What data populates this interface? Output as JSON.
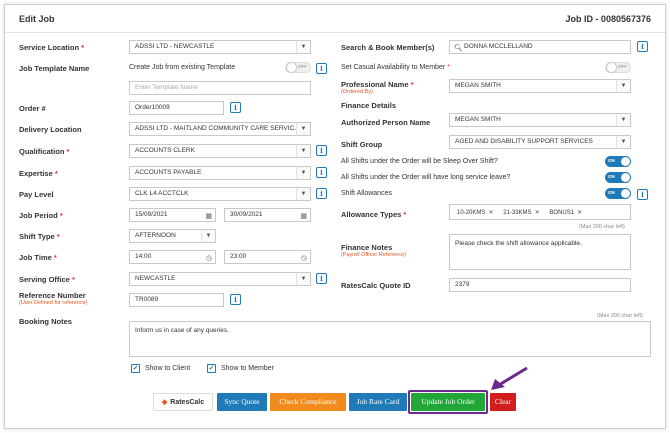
{
  "header": {
    "title": "Edit Job",
    "job_id": "Job ID - 0080567376"
  },
  "left": {
    "service_location": {
      "label": "Service Location",
      "value": "ADSSI LTD - NEWCASTLE"
    },
    "job_template": {
      "label": "Job Template Name",
      "option_label": "Create Job from existing Template",
      "toggle": "OFF",
      "placeholder": "Enter Template Name"
    },
    "order_no": {
      "label": "Order #",
      "value": "Order10009"
    },
    "delivery_location": {
      "label": "Delivery Location",
      "value": "ADSSI LTD - MAITLAND COMMUNITY CARE SERVIC..."
    },
    "qualification": {
      "label": "Qualification",
      "value": "ACCOUNTS CLERK"
    },
    "expertise": {
      "label": "Expertise",
      "value": "ACCOUNTS PAYABLE"
    },
    "pay_level": {
      "label": "Pay Level",
      "value": "CLK L4 ACCTCLK"
    },
    "job_period": {
      "label": "Job Period",
      "start": "15/09/2021",
      "end": "30/09/2021"
    },
    "shift_type": {
      "label": "Shift Type",
      "value": "AFTERNOON"
    },
    "job_time": {
      "label": "Job Time",
      "start": "14:00",
      "end": "23:00"
    },
    "serving_office": {
      "label": "Serving Office",
      "value": "NEWCASTLE"
    },
    "reference_number": {
      "label": "Reference Number",
      "sub": "(User Defined for reference)",
      "value": "TR0089"
    }
  },
  "right": {
    "search_member": {
      "label": "Search & Book Member(s)",
      "value": "DONNA MCCLELLAND"
    },
    "casual_availability": {
      "label": "Set Casual Availability to Member",
      "toggle": "OFF"
    },
    "professional_name": {
      "label": "Professional Name",
      "sub": "(Ordered By)",
      "value": "MEGAN SMITH"
    },
    "finance_details": {
      "label": "Finance Details"
    },
    "authorized_person": {
      "label": "Authorized Person Name",
      "value": "MEGAN SMITH"
    },
    "shift_group": {
      "label": "Shift Group",
      "value": "AGED AND DISABILITY SUPPORT SERVICES"
    },
    "sleep_over": {
      "label": "All Shifts under the Order will be Sleep Over Shift?",
      "toggle": "ON"
    },
    "long_service": {
      "label": "All Shifts under the Order will have long service leave?",
      "toggle": "ON"
    },
    "shift_allowances": {
      "label": "Shift Allowances",
      "toggle": "ON"
    },
    "allowance_types": {
      "label": "Allowance Types",
      "tags": [
        "10-20KMS",
        "21-33KMS",
        "BONUS1"
      ],
      "hint": "(Max 200 char left)"
    },
    "finance_notes": {
      "label": "Finance Notes",
      "sub": "(Payroll Officer Reference)",
      "value": "Please check the shift allowance applicable."
    },
    "ratescalc_quote": {
      "label": "RatesCalc Quote ID",
      "value": "2379"
    }
  },
  "booking_notes": {
    "label": "Booking Notes",
    "hint": "(Max 200 char left)",
    "value": "Inform us in case of any queries."
  },
  "checkboxes": {
    "show_client": "Show to Client",
    "show_member": "Show to Member"
  },
  "buttons": {
    "ratescalc": "RatesCalc",
    "sync_quote": "Sync Quote",
    "check_compliance": "Check Compliance",
    "job_rate_card": "Job Rate Card",
    "update_job_order": "Update Job Order",
    "clear": "Clear"
  },
  "colors": {
    "primary": "#1f7ab8",
    "orange": "#f28b1e",
    "green": "#21a637",
    "red": "#d31c1c",
    "highlight": "#6a2a8e"
  }
}
